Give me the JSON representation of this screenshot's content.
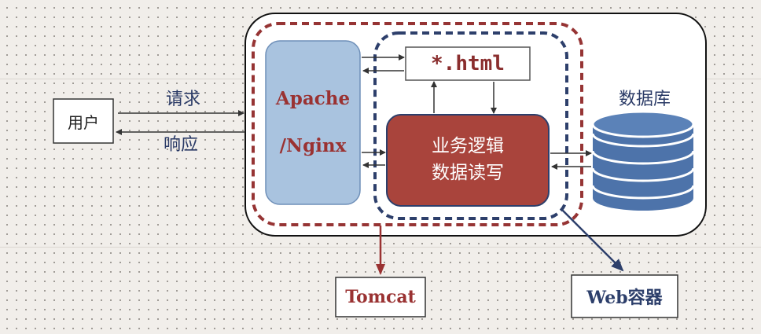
{
  "diagram": {
    "user": "用户",
    "request": "请求",
    "response": "响应",
    "apache": "Apache",
    "nginx": "/Nginx",
    "html": "*.html",
    "logic_line1": "业务逻辑",
    "logic_line2": "数据读写",
    "database": "数据库",
    "tomcat": "Tomcat",
    "web_container": "Web容器"
  },
  "colors": {
    "tomcat_red": "#9a3232",
    "web_blue": "#2d3f6b",
    "apache_box": "#a9c3df",
    "logic_box": "#a9443c",
    "db_cylinder": "#4d73aa"
  }
}
